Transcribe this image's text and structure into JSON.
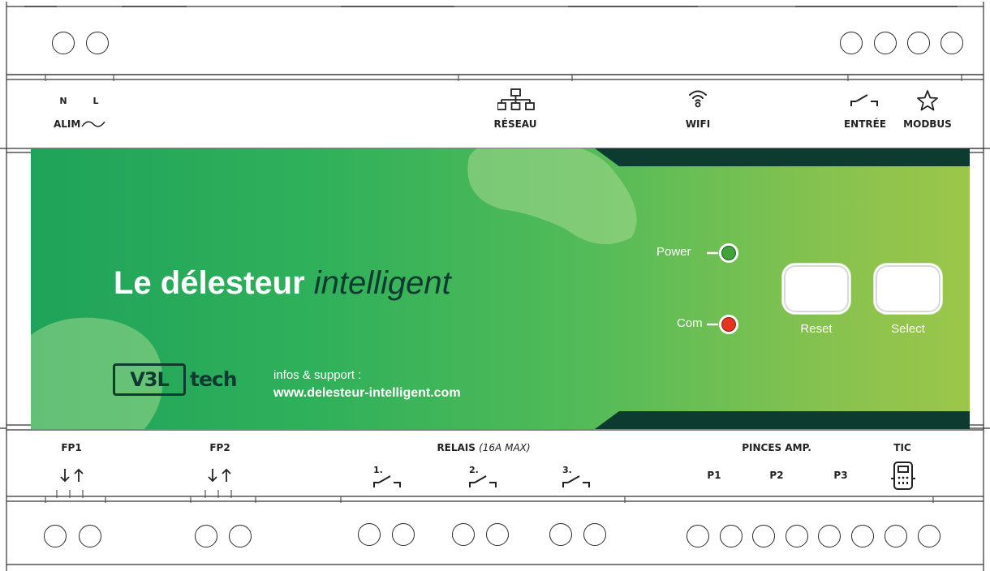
{
  "top_labels": {
    "n": "N",
    "l": "L",
    "alim": "ALIM",
    "reseau": "RÉSEAU",
    "wifi": "WIFI",
    "entree": "ENTRÉE",
    "modbus": "MODBUS"
  },
  "panel": {
    "headline_main": "Le délesteur ",
    "headline_emphasis": "intelligent",
    "logo_box": "V3L",
    "logo_tech": "tech",
    "support_label": "infos & support :",
    "support_url": "www.delesteur-intelligent.com",
    "leds": [
      {
        "label": "Power",
        "color": "#3fa33a"
      },
      {
        "label": "Com",
        "color": "#e5341f"
      }
    ],
    "buttons": [
      {
        "label": "Reset"
      },
      {
        "label": "Select"
      }
    ]
  },
  "bottom_labels": {
    "fp1": "FP1",
    "fp2": "FP2",
    "relais": "RELAIS",
    "relais_note": "(16A MAX)",
    "relay_1": "1.",
    "relay_2": "2.",
    "relay_3": "3.",
    "pinces": "PINCES AMP.",
    "p1": "P1",
    "p2": "P2",
    "p3": "P3",
    "tic": "TIC"
  },
  "colors": {
    "panel_dark": "#0d3b30",
    "gradient_start": "#1fa35a",
    "gradient_end": "#9cc64a"
  }
}
